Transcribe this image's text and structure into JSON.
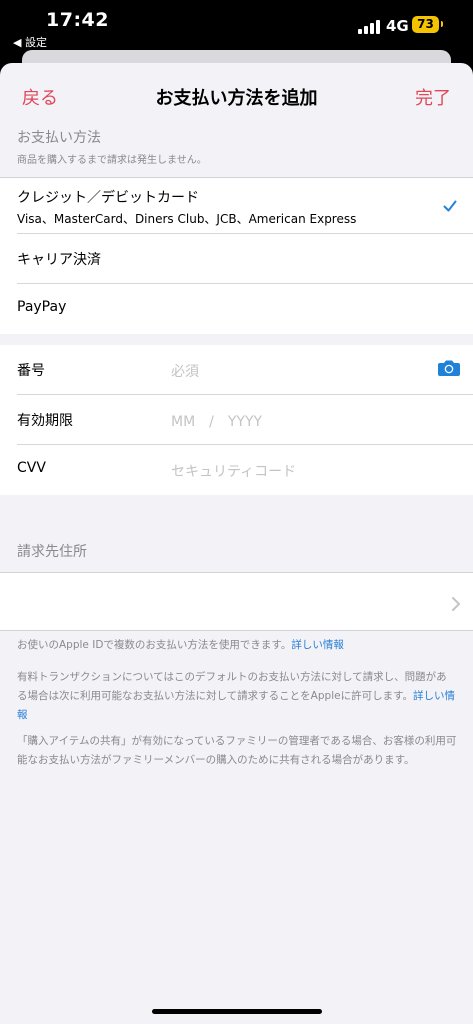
{
  "status_bar": {
    "time": "17:42",
    "back_app": "◀ 設定",
    "network": "4G",
    "battery": "73"
  },
  "nav": {
    "back_label": "戻る",
    "title": "お支払い方法を追加",
    "done_label": "完了"
  },
  "payment_section": {
    "title": "お支払い方法",
    "subtitle": "商品を購入するまで請求は発生しません。",
    "options": [
      {
        "label": "クレジット／デビットカード",
        "sublabel": "Visa、MasterCard、Diners Club、JCB、American Express",
        "selected": true
      },
      {
        "label": "キャリア決済"
      },
      {
        "label": "PayPay"
      }
    ]
  },
  "card_form": {
    "number_label": "番号",
    "number_placeholder": "必須",
    "expiry_label": "有効期限",
    "expiry_placeholder": "MM　/　YYYY",
    "cvv_label": "CVV",
    "cvv_placeholder": "セキュリティコード"
  },
  "billing": {
    "title": "請求先住所",
    "value": ""
  },
  "footnotes": {
    "note1": "お使いのApple IDで複数のお支払い方法を使用できます。",
    "note1_link": "詳しい情報",
    "note2": "有料トランザクションについてはこのデフォルトのお支払い方法に対して請求し、問題がある場合は次に利用可能なお支払い方法に対して請求することをAppleに許可します。",
    "note2_link": "詳しい情報",
    "note3": "「購入アイテムの共有」が有効になっているファミリーの管理者である場合、お客様の利用可能なお支払い方法がファミリーメンバーの購入のために共有される場合があります。"
  },
  "colors": {
    "accent_red": "#e0475a",
    "link_blue": "#2a80d6",
    "checkmark_blue": "#2a80d6",
    "camera_blue": "#1e82d8"
  },
  "icons": {
    "check": "checkmark-icon",
    "camera": "camera-icon",
    "chevron": "chevron-right-icon",
    "signal": "cellular-signal-icon",
    "battery": "battery-icon"
  }
}
